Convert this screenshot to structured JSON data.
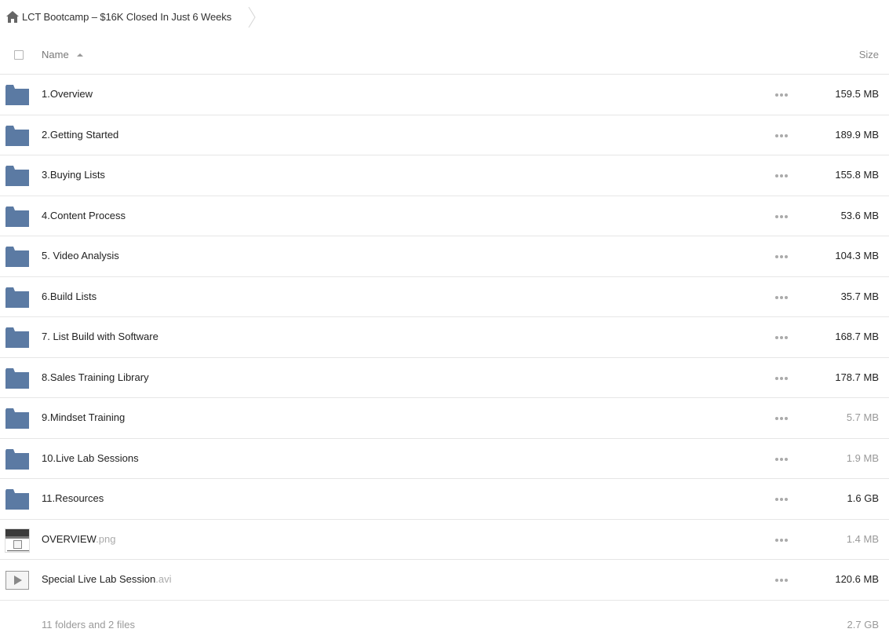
{
  "breadcrumb": {
    "icon": "home-icon",
    "title": "LCT Bootcamp – $16K Closed In Just 6 Weeks"
  },
  "header": {
    "name_label": "Name",
    "size_label": "Size"
  },
  "colors": {
    "folder": "#5b7aa3",
    "muted": "#999999"
  },
  "rows": [
    {
      "type": "folder",
      "name": "1.Overview",
      "ext": "",
      "size": "159.5 MB",
      "muted": false
    },
    {
      "type": "folder",
      "name": "2.Getting Started",
      "ext": "",
      "size": "189.9 MB",
      "muted": false
    },
    {
      "type": "folder",
      "name": "3.Buying Lists",
      "ext": "",
      "size": "155.8 MB",
      "muted": false
    },
    {
      "type": "folder",
      "name": "4.Content Process",
      "ext": "",
      "size": "53.6 MB",
      "muted": false
    },
    {
      "type": "folder",
      "name": "5. Video Analysis",
      "ext": "",
      "size": "104.3 MB",
      "muted": false
    },
    {
      "type": "folder",
      "name": "6.Build Lists",
      "ext": "",
      "size": "35.7 MB",
      "muted": false
    },
    {
      "type": "folder",
      "name": "7. List Build with Software",
      "ext": "",
      "size": "168.7 MB",
      "muted": false
    },
    {
      "type": "folder",
      "name": "8.Sales Training Library",
      "ext": "",
      "size": "178.7 MB",
      "muted": false
    },
    {
      "type": "folder",
      "name": "9.Mindset Training",
      "ext": "",
      "size": "5.7 MB",
      "muted": true
    },
    {
      "type": "folder",
      "name": "10.Live Lab Sessions",
      "ext": "",
      "size": "1.9 MB",
      "muted": true
    },
    {
      "type": "folder",
      "name": "11.Resources",
      "ext": "",
      "size": "1.6 GB",
      "muted": false
    },
    {
      "type": "image",
      "name": "OVERVIEW",
      "ext": ".png",
      "size": "1.4 MB",
      "muted": true
    },
    {
      "type": "video",
      "name": "Special Live Lab Session",
      "ext": ".avi",
      "size": "120.6 MB",
      "muted": false
    }
  ],
  "footer": {
    "summary": "11 folders and 2 files",
    "total": "2.7 GB"
  }
}
